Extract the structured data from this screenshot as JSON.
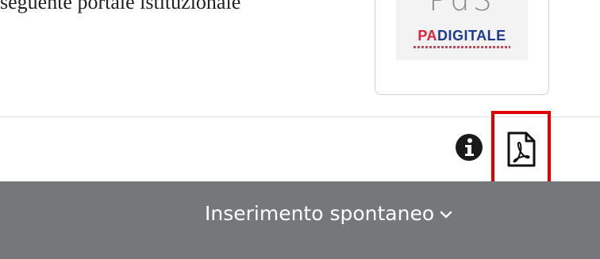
{
  "header": {
    "caption": "seguente portale istituzionale"
  },
  "logo": {
    "top_text": "PdS",
    "word_pa": "PA",
    "word_digitale": "DIGITALE"
  },
  "icons": {
    "info": "info-icon",
    "pdf": "pdf-icon",
    "chevron": "chevron-down-icon"
  },
  "nav": {
    "menu_label": "Inserimento spontaneo"
  },
  "colors": {
    "bar": "#75777b",
    "highlight": "#e00000",
    "brand_red": "#e0223a",
    "brand_blue": "#1d3a8f"
  }
}
